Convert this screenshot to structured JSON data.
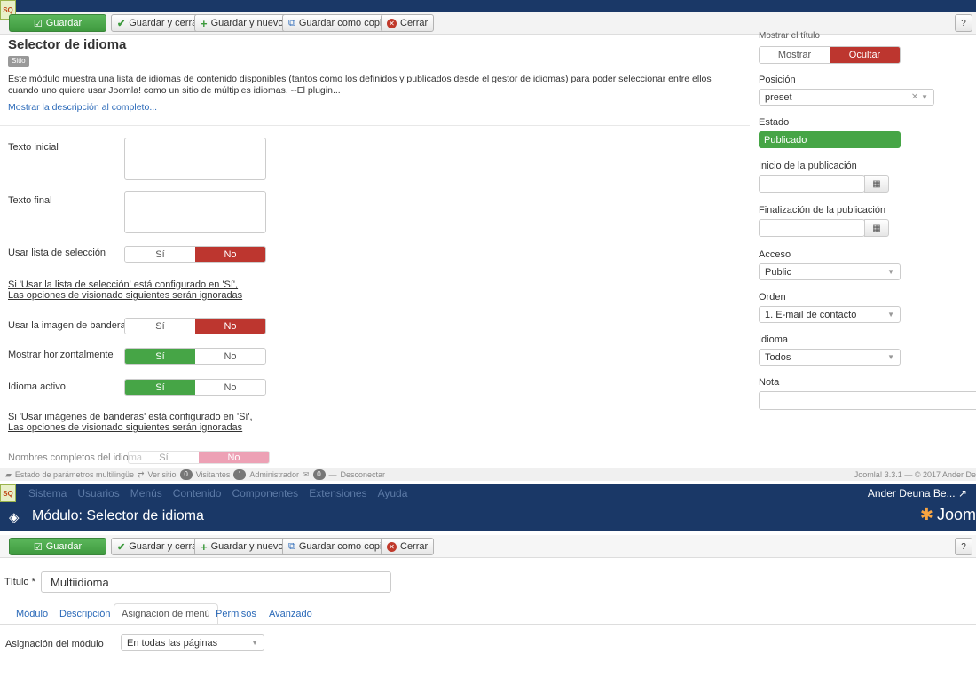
{
  "toolbar": {
    "save": "Guardar",
    "save_close": "Guardar y cerrar",
    "save_new": "Guardar y nuevo",
    "save_copy": "Guardar como copia",
    "close": "Cerrar"
  },
  "module": {
    "title": "Selector de idioma",
    "site_badge": "Sitio",
    "description": "Este módulo muestra una lista de idiomas de contenido disponibles (tantos como los definidos y publicados desde el gestor de idiomas) para poder seleccionar entre ellos cuando uno quiere usar Joomla! como un sitio de múltiples idiomas. --El plugin...",
    "show_full_desc": "Mostrar la descripción al completo..."
  },
  "form": {
    "pretext_label": "Texto inicial",
    "posttext_label": "Texto final",
    "use_dropdown_label": "Usar lista de selección",
    "yes": "Sí",
    "no": "No",
    "note1_line1": "Si 'Usar la lista de selección' está configurado en 'Sí',",
    "note1_line2": "Las opciones de visionado siguientes serán ignoradas",
    "use_flags_label": "Usar la imagen de banderas",
    "horizontal_label": "Mostrar horizontalmente",
    "active_lang_label": "Idioma activo",
    "note2_line1": "Si 'Usar imágenes de banderas' está configurado en 'Sí',",
    "note2_line2": "Las opciones de visionado siguientes serán ignoradas",
    "full_names_label": "Nombres completos del idioma"
  },
  "sidebar": {
    "show_title_label": "Mostrar el título",
    "show": "Mostrar",
    "hide": "Ocultar",
    "position_label": "Posición",
    "position_value": "preset",
    "status_label": "Estado",
    "status_value": "Publicado",
    "publish_up_label": "Inicio de la publicación",
    "publish_down_label": "Finalización de la publicación",
    "access_label": "Acceso",
    "access_value": "Public",
    "order_label": "Orden",
    "order_value": "1. E-mail de contacto",
    "language_label": "Idioma",
    "language_value": "Todos",
    "note_label": "Nota"
  },
  "statusbar": {
    "multilang": "Estado de parámetros multilingüe",
    "view_site": "Ver sitio",
    "visitors_count": "0",
    "visitors": "Visitantes",
    "admin_count": "1",
    "admin": "Administrador",
    "msg_count": "0",
    "logout": "Desconectar",
    "copyright": "Joomla! 3.3.1 — © 2017 Ander De"
  },
  "menu": {
    "items": [
      "Sistema",
      "Usuarios",
      "Menús",
      "Contenido",
      "Componentes",
      "Extensiones",
      "Ayuda"
    ],
    "user": "Ander Deuna Be..."
  },
  "page2": {
    "title": "Módulo: Selector de idioma",
    "brand": "Joom",
    "title_field_label": "Título *",
    "title_field_value": "Multiidioma",
    "tabs": [
      "Módulo",
      "Descripción",
      "Asignación de menú",
      "Permisos",
      "Avanzado"
    ],
    "assignment_label": "Asignación del módulo",
    "assignment_value": "En todas las páginas"
  },
  "colors": {
    "navy": "#1a3867",
    "green": "#46a546",
    "red": "#bd362f",
    "link": "#2a69b8"
  }
}
